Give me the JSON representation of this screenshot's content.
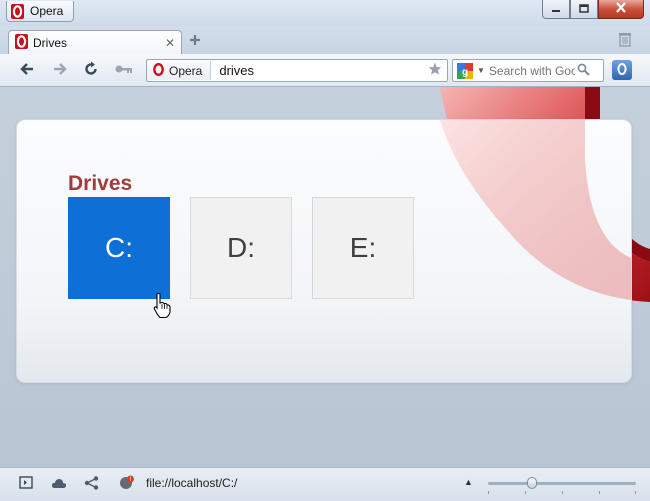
{
  "window": {
    "menu_label": "Opera"
  },
  "tab": {
    "title": "Drives",
    "close_glyph": "✕",
    "new_tab_glyph": "+"
  },
  "toolbar": {
    "address_badge": "Opera",
    "address_value": "drives",
    "search_placeholder": "Search with Google"
  },
  "page": {
    "heading": "Drives",
    "drives": [
      {
        "label": "C:",
        "selected": true
      },
      {
        "label": "D:",
        "selected": false
      },
      {
        "label": "E:",
        "selected": false
      }
    ],
    "accent_color": "#0e6fd6",
    "heading_color": "#a03c3c"
  },
  "statusbar": {
    "url": "file://localhost/C:/",
    "zoom_level": 0.3
  },
  "icons": [
    "opera-logo-icon",
    "minimize-icon",
    "maximize-icon",
    "close-icon",
    "tab-close-icon",
    "new-tab-icon",
    "trash-icon",
    "back-icon",
    "forward-icon",
    "reload-icon",
    "key-icon",
    "star-icon",
    "google-icon",
    "dropdown-icon",
    "search-icon",
    "extension-icon",
    "panel-toggle-icon",
    "cloud-icon",
    "share-icon",
    "unite-icon",
    "hand-cursor-icon"
  ]
}
